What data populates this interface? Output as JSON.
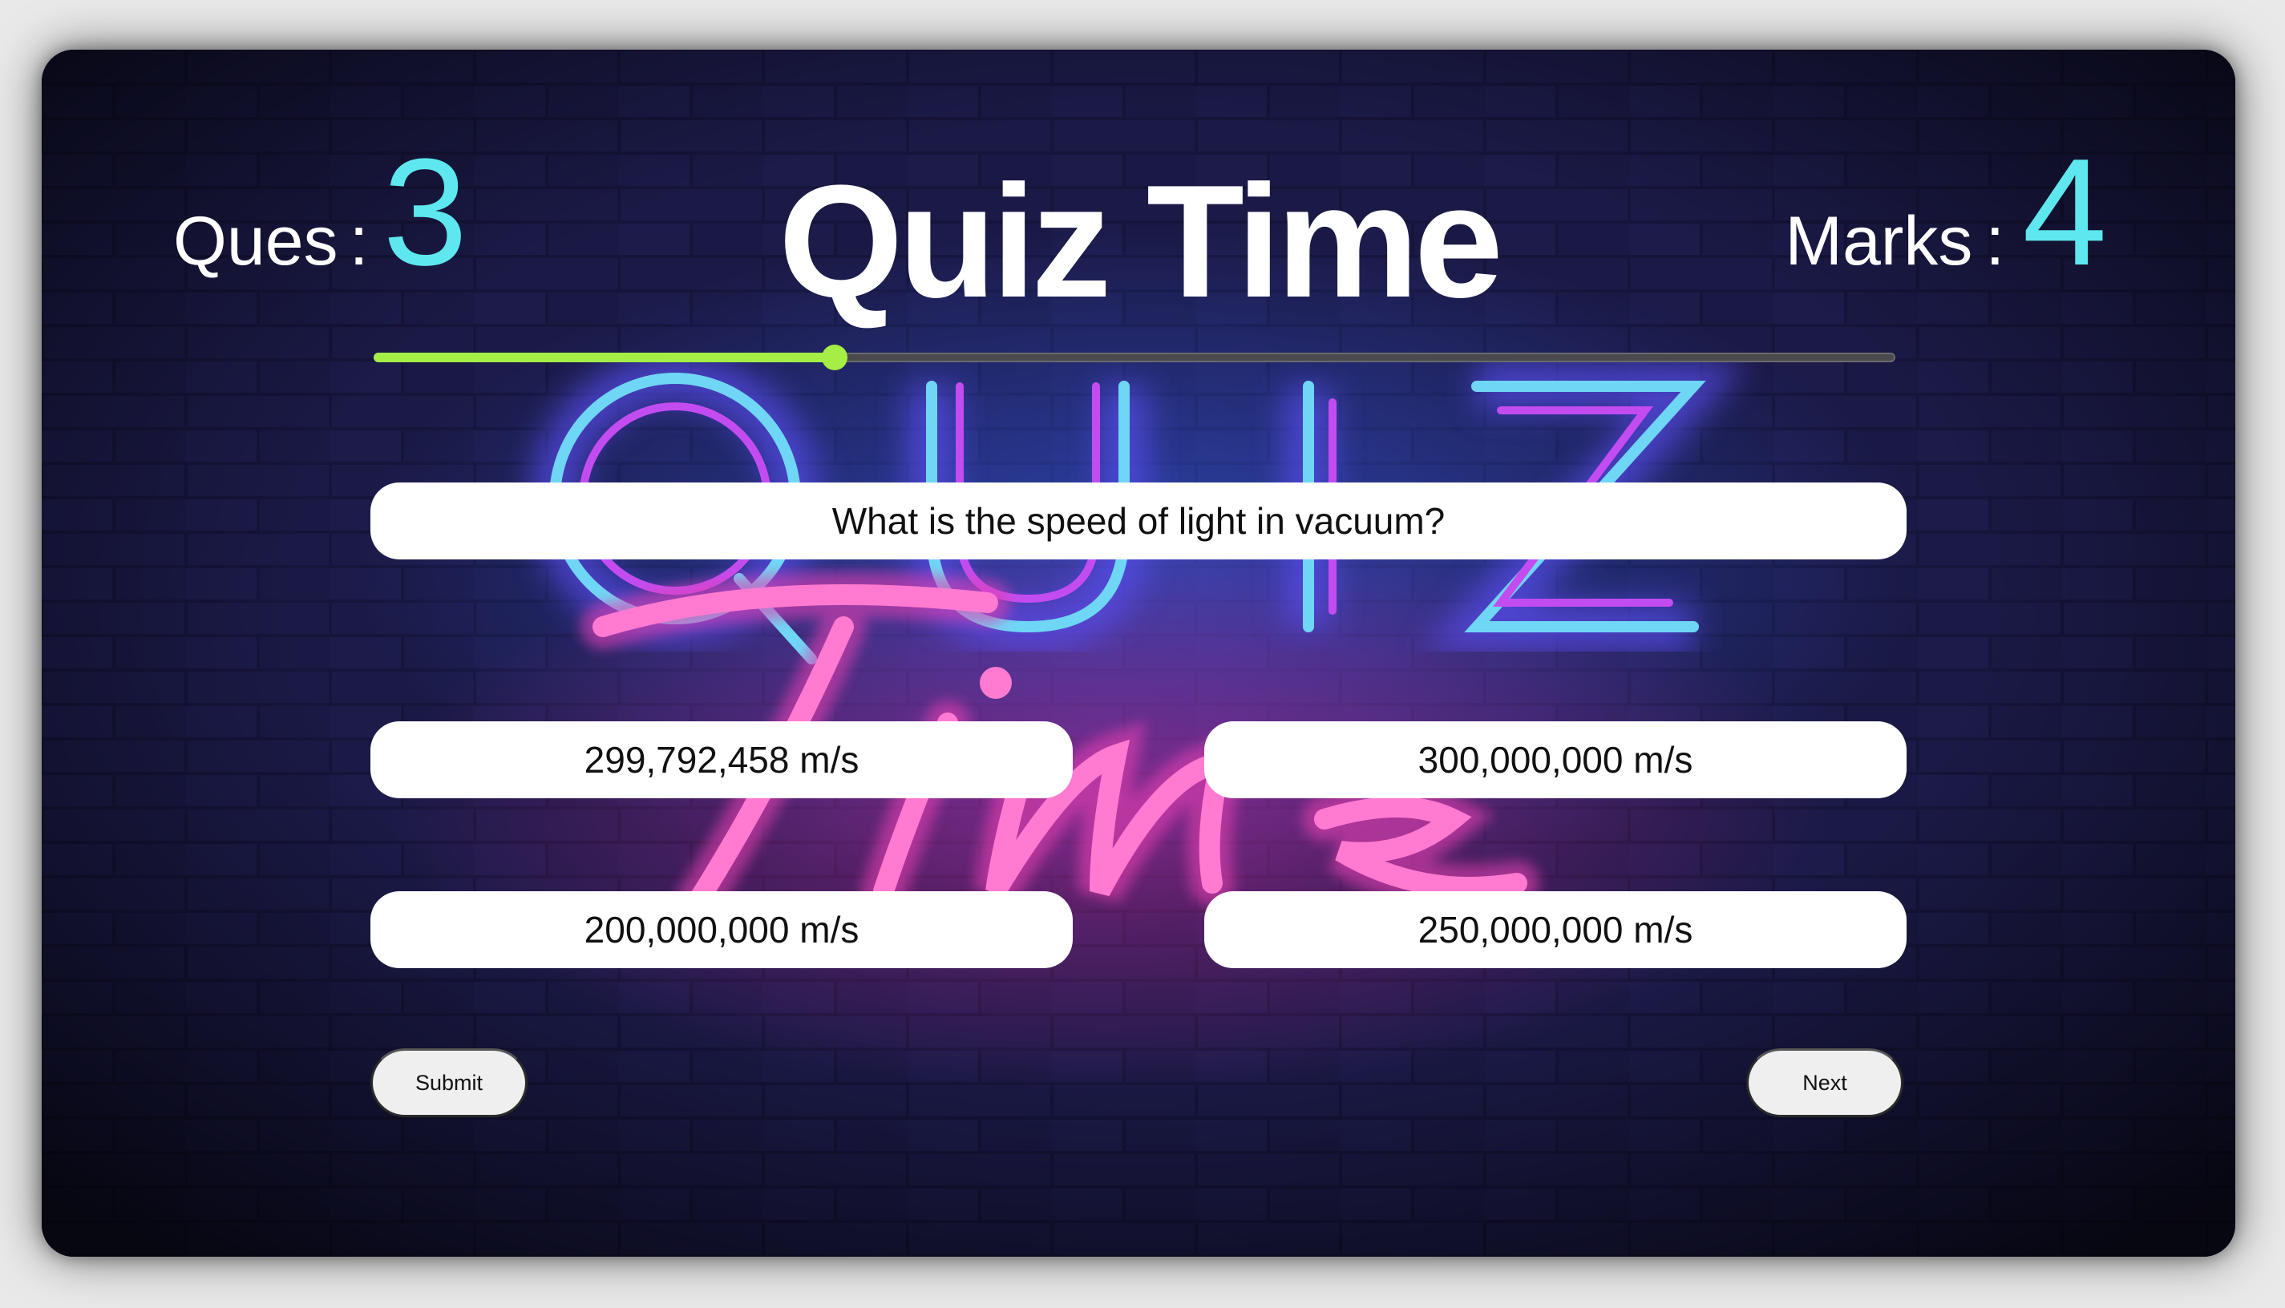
{
  "header": {
    "ques_label": "Ques",
    "separator": ":",
    "ques_value": "3",
    "title": "Quiz Time",
    "marks_label": "Marks",
    "marks_value": "4"
  },
  "progress": {
    "fraction": 0.303,
    "fill_color": "#a4ee45",
    "track_color": "#4a4a4e"
  },
  "question": {
    "text": "What is the speed of light in vacuum?"
  },
  "options": [
    "299,792,458 m/s",
    "300,000,000 m/s",
    "200,000,000 m/s",
    "250,000,000 m/s"
  ],
  "buttons": {
    "submit_label": "Submit",
    "next_label": "Next"
  },
  "colors": {
    "accent": "#5ee7ee",
    "neon_pink": "#e23fb2",
    "neon_blue": "#3fb6f0",
    "background": "#0d0c24"
  },
  "background_art": {
    "icon": "neon-quiz-sign-brick-wall"
  }
}
